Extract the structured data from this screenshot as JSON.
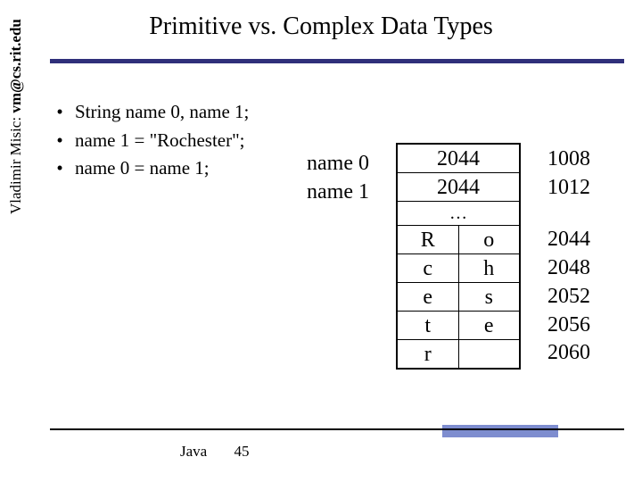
{
  "slide": {
    "title": "Primitive vs. Complex Data Types"
  },
  "author": {
    "name": "Vladimir Misic:",
    "email": "vm@cs.rit.edu"
  },
  "bullets": {
    "dot": "•",
    "b0": "String name 0, name 1;",
    "b1": "name 1 = \"Rochester\";",
    "b2": "name 0 = name 1;"
  },
  "varlabels": {
    "v0": "name 0",
    "v1": "name 1"
  },
  "mem": {
    "r0": "2044",
    "r1": "2044",
    "ellipsis": "…",
    "r3a": "R",
    "r3b": "o",
    "r4a": "c",
    "r4b": "h",
    "r5a": "e",
    "r5b": "s",
    "r6a": "t",
    "r6b": "e",
    "r7a": "r",
    "r7b": ""
  },
  "addr": {
    "a0": "1008",
    "a1": "1012",
    "a2": "2044",
    "a3": "2048",
    "a4": "2052",
    "a5": "2056",
    "a6": "2060"
  },
  "footer": {
    "label": "Java",
    "page": "45"
  }
}
